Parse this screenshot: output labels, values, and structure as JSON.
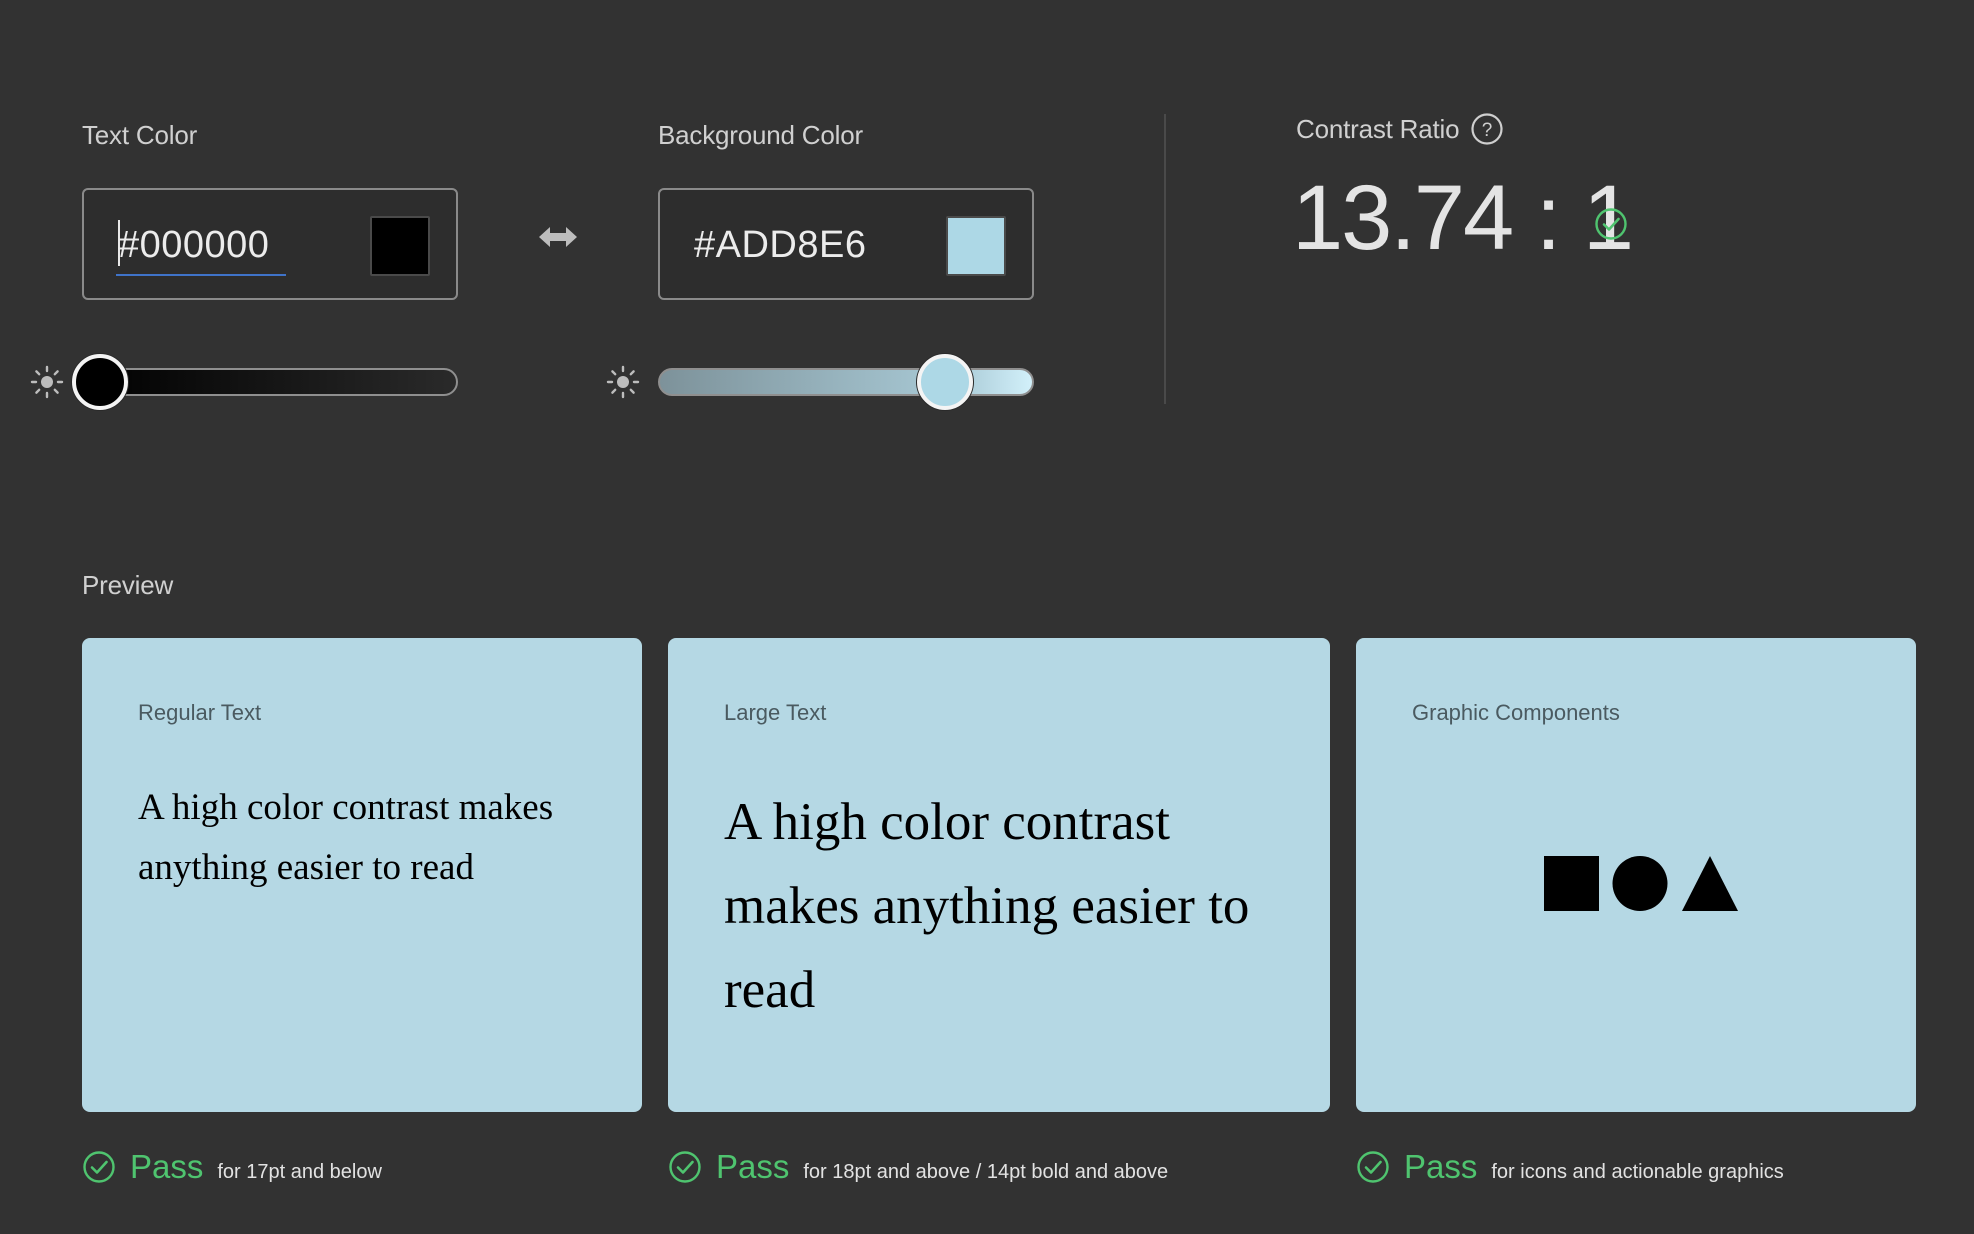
{
  "text_color": {
    "label": "Text Color",
    "hex_value": "#000000",
    "swatch_color": "#000000",
    "brightness_level": 0.0
  },
  "background_color": {
    "label": "Background Color",
    "hex_value": "#ADD8E6",
    "swatch_color": "#ADD8E6",
    "brightness_level": 0.79
  },
  "swap": {
    "icon": "swap-horizontal-icon"
  },
  "contrast": {
    "label": "Contrast Ratio",
    "value": "13.74 : 1",
    "help_icon": "question-circle-icon",
    "status_icon": "check-circle-icon"
  },
  "preview": {
    "label": "Preview",
    "cards": [
      {
        "label": "Regular Text",
        "sample": "A high color contrast makes anything easier to read",
        "result": "Pass",
        "description": "for 17pt and below"
      },
      {
        "label": "Large Text",
        "sample": "A high color contrast makes anything easier to read",
        "result": "Pass",
        "description": "for 18pt and above / 14pt bold and above"
      },
      {
        "label": "Graphic Components",
        "shapes": [
          "square",
          "circle",
          "triangle"
        ],
        "result": "Pass",
        "description": "for icons and actionable graphics"
      }
    ]
  },
  "colors": {
    "page_background": "#323232",
    "preview_background": "#B5D8E4",
    "pass_green": "#4FC46F",
    "focus_underline": "#3F73C9"
  }
}
